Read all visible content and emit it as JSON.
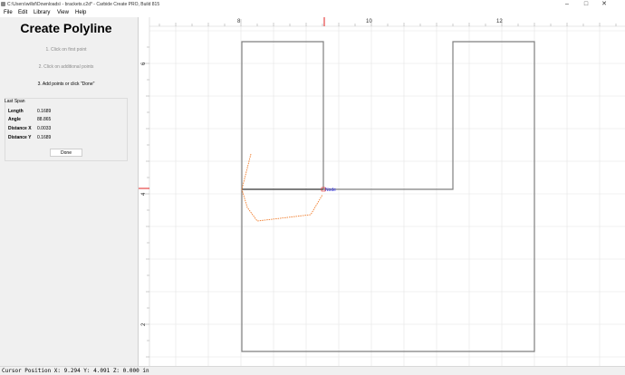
{
  "window": {
    "title": "C:\\Users\\willsf\\Downloads\\ - brackets.c2d* - Carbide Create PRO, Build 815",
    "controls": [
      "–",
      "□",
      "✕"
    ]
  },
  "menu": [
    "File",
    "Edit",
    "Library",
    "View",
    "Help"
  ],
  "panel": {
    "title": "Create Polyline",
    "steps": [
      "1. Click on first point",
      "2. Click on additional points",
      "3. Add points or click \"Done\""
    ],
    "last_span": {
      "title": "Last Span",
      "rows": [
        {
          "label": "Length",
          "value": "0.1689"
        },
        {
          "label": "Angle",
          "value": "88.865"
        },
        {
          "label": "Distance X",
          "value": "0.0033"
        },
        {
          "label": "Distance Y",
          "value": "0.1689"
        }
      ]
    },
    "done_label": "Done"
  },
  "canvas": {
    "x_ruler_labels": [
      "8",
      "10",
      "12"
    ],
    "y_ruler_labels": [
      "6",
      "4",
      "2"
    ],
    "node_label": "Node",
    "colors": {
      "grid": "#e4e4e4",
      "shape": "#7f7f7f",
      "polyline": "#f07a28",
      "cursor": "#e02020",
      "node": "#1f1fe0"
    }
  },
  "status": {
    "text": "Cursor Position X: 9.294 Y: 4.091 Z: 0.000 in"
  }
}
